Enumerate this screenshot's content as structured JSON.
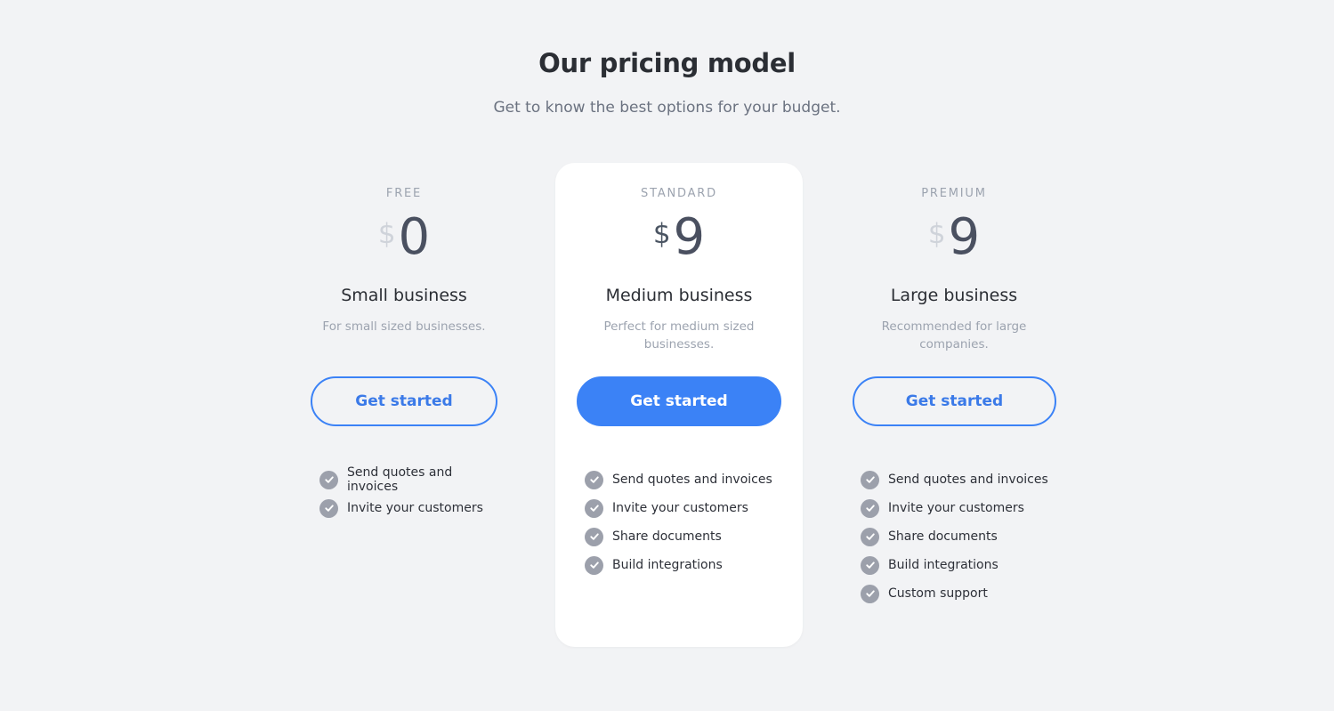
{
  "header": {
    "title": "Our pricing model",
    "subtitle": "Get to know the best options for your budget."
  },
  "plans": [
    {
      "tier": "FREE",
      "currency": "$",
      "price": "0",
      "name": "Small business",
      "description": "For small sized businesses.",
      "cta_label": "Get started",
      "features": [
        "Send quotes and invoices",
        "Invite your customers"
      ]
    },
    {
      "tier": "STANDARD",
      "currency": "$",
      "price": "9",
      "name": "Medium business",
      "description": "Perfect for medium sized businesses.",
      "cta_label": "Get started",
      "features": [
        "Send quotes and invoices",
        "Invite your customers",
        "Share documents",
        "Build integrations"
      ]
    },
    {
      "tier": "PREMIUM",
      "currency": "$",
      "price": "9",
      "name": "Large business",
      "description": "Recommended for large companies.",
      "cta_label": "Get started",
      "features": [
        "Send quotes and invoices",
        "Invite your customers",
        "Share documents",
        "Build integrations",
        "Custom support"
      ]
    }
  ],
  "colors": {
    "accent": "#3b82f6",
    "background": "#f2f3f5",
    "card": "#ffffff",
    "check": "#9ca0ab"
  }
}
